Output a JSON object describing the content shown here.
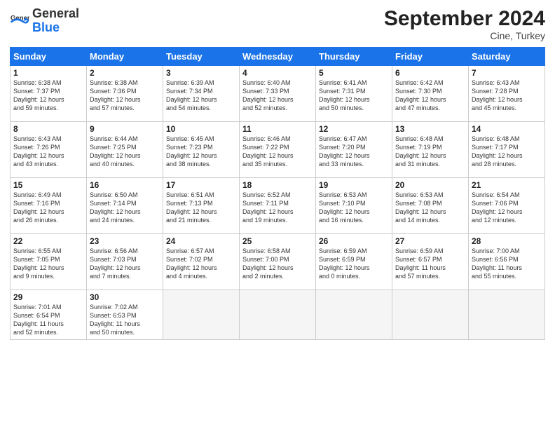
{
  "header": {
    "logo_general": "General",
    "logo_blue": "Blue",
    "month_title": "September 2024",
    "location": "Cine, Turkey"
  },
  "columns": [
    "Sunday",
    "Monday",
    "Tuesday",
    "Wednesday",
    "Thursday",
    "Friday",
    "Saturday"
  ],
  "rows": [
    [
      {
        "day": "1",
        "lines": [
          "Sunrise: 6:38 AM",
          "Sunset: 7:37 PM",
          "Daylight: 12 hours",
          "and 59 minutes."
        ]
      },
      {
        "day": "2",
        "lines": [
          "Sunrise: 6:38 AM",
          "Sunset: 7:36 PM",
          "Daylight: 12 hours",
          "and 57 minutes."
        ]
      },
      {
        "day": "3",
        "lines": [
          "Sunrise: 6:39 AM",
          "Sunset: 7:34 PM",
          "Daylight: 12 hours",
          "and 54 minutes."
        ]
      },
      {
        "day": "4",
        "lines": [
          "Sunrise: 6:40 AM",
          "Sunset: 7:33 PM",
          "Daylight: 12 hours",
          "and 52 minutes."
        ]
      },
      {
        "day": "5",
        "lines": [
          "Sunrise: 6:41 AM",
          "Sunset: 7:31 PM",
          "Daylight: 12 hours",
          "and 50 minutes."
        ]
      },
      {
        "day": "6",
        "lines": [
          "Sunrise: 6:42 AM",
          "Sunset: 7:30 PM",
          "Daylight: 12 hours",
          "and 47 minutes."
        ]
      },
      {
        "day": "7",
        "lines": [
          "Sunrise: 6:43 AM",
          "Sunset: 7:28 PM",
          "Daylight: 12 hours",
          "and 45 minutes."
        ]
      }
    ],
    [
      {
        "day": "8",
        "lines": [
          "Sunrise: 6:43 AM",
          "Sunset: 7:26 PM",
          "Daylight: 12 hours",
          "and 43 minutes."
        ]
      },
      {
        "day": "9",
        "lines": [
          "Sunrise: 6:44 AM",
          "Sunset: 7:25 PM",
          "Daylight: 12 hours",
          "and 40 minutes."
        ]
      },
      {
        "day": "10",
        "lines": [
          "Sunrise: 6:45 AM",
          "Sunset: 7:23 PM",
          "Daylight: 12 hours",
          "and 38 minutes."
        ]
      },
      {
        "day": "11",
        "lines": [
          "Sunrise: 6:46 AM",
          "Sunset: 7:22 PM",
          "Daylight: 12 hours",
          "and 35 minutes."
        ]
      },
      {
        "day": "12",
        "lines": [
          "Sunrise: 6:47 AM",
          "Sunset: 7:20 PM",
          "Daylight: 12 hours",
          "and 33 minutes."
        ]
      },
      {
        "day": "13",
        "lines": [
          "Sunrise: 6:48 AM",
          "Sunset: 7:19 PM",
          "Daylight: 12 hours",
          "and 31 minutes."
        ]
      },
      {
        "day": "14",
        "lines": [
          "Sunrise: 6:48 AM",
          "Sunset: 7:17 PM",
          "Daylight: 12 hours",
          "and 28 minutes."
        ]
      }
    ],
    [
      {
        "day": "15",
        "lines": [
          "Sunrise: 6:49 AM",
          "Sunset: 7:16 PM",
          "Daylight: 12 hours",
          "and 26 minutes."
        ]
      },
      {
        "day": "16",
        "lines": [
          "Sunrise: 6:50 AM",
          "Sunset: 7:14 PM",
          "Daylight: 12 hours",
          "and 24 minutes."
        ]
      },
      {
        "day": "17",
        "lines": [
          "Sunrise: 6:51 AM",
          "Sunset: 7:13 PM",
          "Daylight: 12 hours",
          "and 21 minutes."
        ]
      },
      {
        "day": "18",
        "lines": [
          "Sunrise: 6:52 AM",
          "Sunset: 7:11 PM",
          "Daylight: 12 hours",
          "and 19 minutes."
        ]
      },
      {
        "day": "19",
        "lines": [
          "Sunrise: 6:53 AM",
          "Sunset: 7:10 PM",
          "Daylight: 12 hours",
          "and 16 minutes."
        ]
      },
      {
        "day": "20",
        "lines": [
          "Sunrise: 6:53 AM",
          "Sunset: 7:08 PM",
          "Daylight: 12 hours",
          "and 14 minutes."
        ]
      },
      {
        "day": "21",
        "lines": [
          "Sunrise: 6:54 AM",
          "Sunset: 7:06 PM",
          "Daylight: 12 hours",
          "and 12 minutes."
        ]
      }
    ],
    [
      {
        "day": "22",
        "lines": [
          "Sunrise: 6:55 AM",
          "Sunset: 7:05 PM",
          "Daylight: 12 hours",
          "and 9 minutes."
        ]
      },
      {
        "day": "23",
        "lines": [
          "Sunrise: 6:56 AM",
          "Sunset: 7:03 PM",
          "Daylight: 12 hours",
          "and 7 minutes."
        ]
      },
      {
        "day": "24",
        "lines": [
          "Sunrise: 6:57 AM",
          "Sunset: 7:02 PM",
          "Daylight: 12 hours",
          "and 4 minutes."
        ]
      },
      {
        "day": "25",
        "lines": [
          "Sunrise: 6:58 AM",
          "Sunset: 7:00 PM",
          "Daylight: 12 hours",
          "and 2 minutes."
        ]
      },
      {
        "day": "26",
        "lines": [
          "Sunrise: 6:59 AM",
          "Sunset: 6:59 PM",
          "Daylight: 12 hours",
          "and 0 minutes."
        ]
      },
      {
        "day": "27",
        "lines": [
          "Sunrise: 6:59 AM",
          "Sunset: 6:57 PM",
          "Daylight: 11 hours",
          "and 57 minutes."
        ]
      },
      {
        "day": "28",
        "lines": [
          "Sunrise: 7:00 AM",
          "Sunset: 6:56 PM",
          "Daylight: 11 hours",
          "and 55 minutes."
        ]
      }
    ],
    [
      {
        "day": "29",
        "lines": [
          "Sunrise: 7:01 AM",
          "Sunset: 6:54 PM",
          "Daylight: 11 hours",
          "and 52 minutes."
        ]
      },
      {
        "day": "30",
        "lines": [
          "Sunrise: 7:02 AM",
          "Sunset: 6:53 PM",
          "Daylight: 11 hours",
          "and 50 minutes."
        ]
      },
      {
        "day": "",
        "lines": []
      },
      {
        "day": "",
        "lines": []
      },
      {
        "day": "",
        "lines": []
      },
      {
        "day": "",
        "lines": []
      },
      {
        "day": "",
        "lines": []
      }
    ]
  ]
}
